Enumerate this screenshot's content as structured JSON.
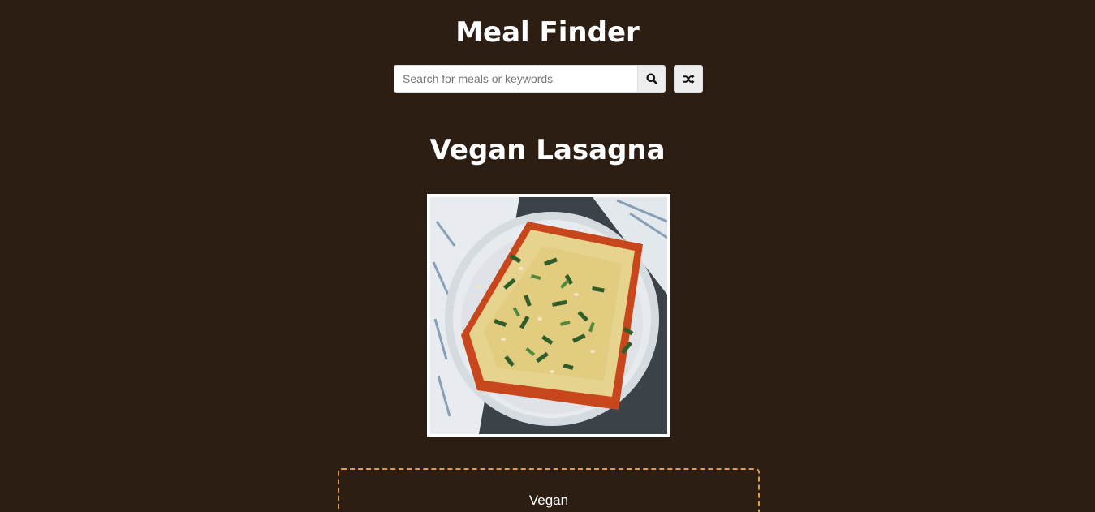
{
  "header": {
    "title": "Meal Finder"
  },
  "search": {
    "placeholder": "Search for meals or keywords",
    "value": "",
    "search_icon": "search-icon",
    "random_icon": "shuffle-icon"
  },
  "meal": {
    "title": "Vegan Lasagna",
    "image_alt": "Vegan Lasagna",
    "category": "Vegan"
  },
  "colors": {
    "background": "#2c1e13",
    "accent_border": "#e09b4c",
    "text": "#ffffff"
  }
}
